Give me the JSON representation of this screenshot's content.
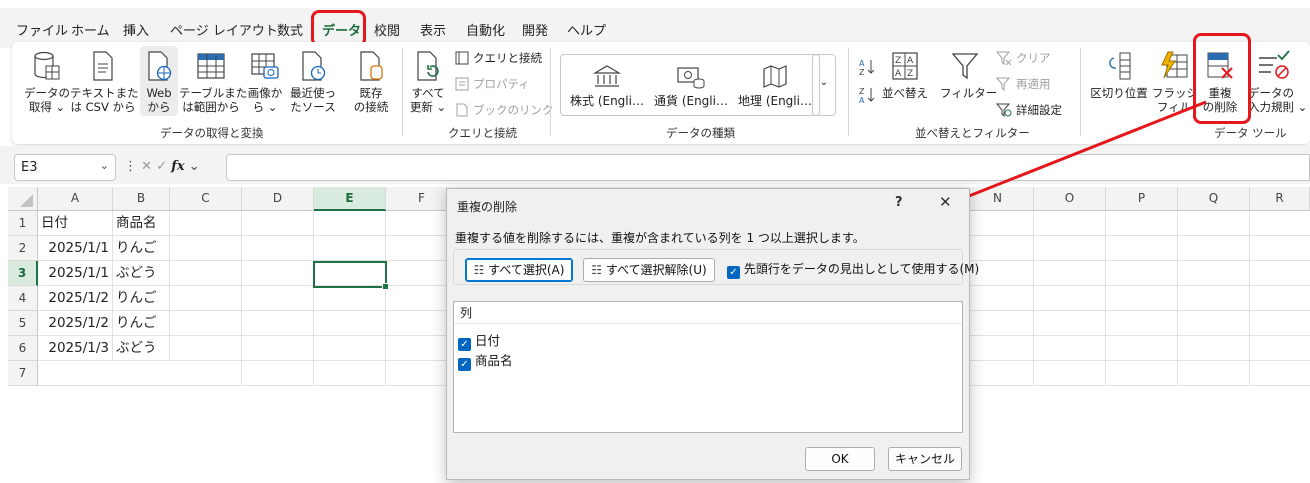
{
  "tabs": [
    "ファイル",
    "ホーム",
    "挿入",
    "ページ レイアウト",
    "数式",
    "データ",
    "校閲",
    "表示",
    "自動化",
    "開発",
    "ヘルプ"
  ],
  "active_tab": "データ",
  "ribbon": {
    "get_data": {
      "label": "データの取得と変換",
      "buttons": {
        "get_data": [
          "データの",
          "取得 ⌄"
        ],
        "text_csv": [
          "テキストまた",
          "は CSV から"
        ],
        "web": [
          "Web",
          "から"
        ],
        "table_range": [
          "テーブルまた",
          "は範囲から"
        ],
        "image": [
          "画像か",
          "ら ⌄"
        ],
        "recent": [
          "最近使っ",
          "たソース"
        ],
        "existing": [
          "既存",
          "の接続"
        ]
      }
    },
    "queries": {
      "label": "クエリと接続",
      "refresh": [
        "すべて",
        "更新 ⌄"
      ],
      "queries_connections": "クエリと接続",
      "properties": "プロパティ",
      "edit_links": "ブックのリンク"
    },
    "data_types": {
      "label": "データの種類",
      "items": [
        "株式 (Engli…",
        "通貨 (Engli…",
        "地理 (Engli…"
      ]
    },
    "sort_filter": {
      "label": "並べ替えとフィルター",
      "sort": "並べ替え",
      "filter": "フィルター",
      "clear": "クリア",
      "reapply": "再適用",
      "advanced": "詳細設定"
    },
    "data_tools": {
      "label": "データ ツール",
      "text_to_columns": "区切り位置",
      "flash_fill": [
        "フラッシュ",
        "フィル"
      ],
      "remove_duplicates": [
        "重複",
        "の削除"
      ],
      "validation": [
        "データの",
        "入力規則 ⌄"
      ]
    }
  },
  "formula_bar": {
    "name_box": "E3",
    "fx": "fx",
    "value": ""
  },
  "sheet": {
    "columns": [
      "A",
      "B",
      "C",
      "D",
      "E",
      "F",
      "G",
      "H",
      "I",
      "J",
      "K",
      "L",
      "M",
      "N",
      "O",
      "P",
      "Q",
      "R"
    ],
    "rows": [
      "1",
      "2",
      "3",
      "4",
      "5",
      "6",
      "7"
    ],
    "selected_cell": "E3",
    "data": [
      [
        "日付",
        "商品名"
      ],
      [
        "2025/1/1",
        "りんご"
      ],
      [
        "2025/1/1",
        "ぶどう"
      ],
      [
        "2025/1/2",
        "りんご"
      ],
      [
        "2025/1/2",
        "りんご"
      ],
      [
        "2025/1/3",
        "ぶどう"
      ]
    ]
  },
  "dialog": {
    "title": "重複の削除",
    "help": "?",
    "close": "✕",
    "instruction": "重複する値を削除するには、重複が含まれている列を 1 つ以上選択します。",
    "select_all": "すべて選択(A)",
    "unselect_all": "すべて選択解除(U)",
    "has_headers": "先頭行をデータの見出しとして使用する(M)",
    "has_headers_checked": true,
    "list_header": "列",
    "columns": [
      {
        "name": "日付",
        "checked": true
      },
      {
        "name": "商品名",
        "checked": true
      }
    ],
    "ok": "OK",
    "cancel": "キャンセル"
  },
  "annotation_color": "#e5161c"
}
